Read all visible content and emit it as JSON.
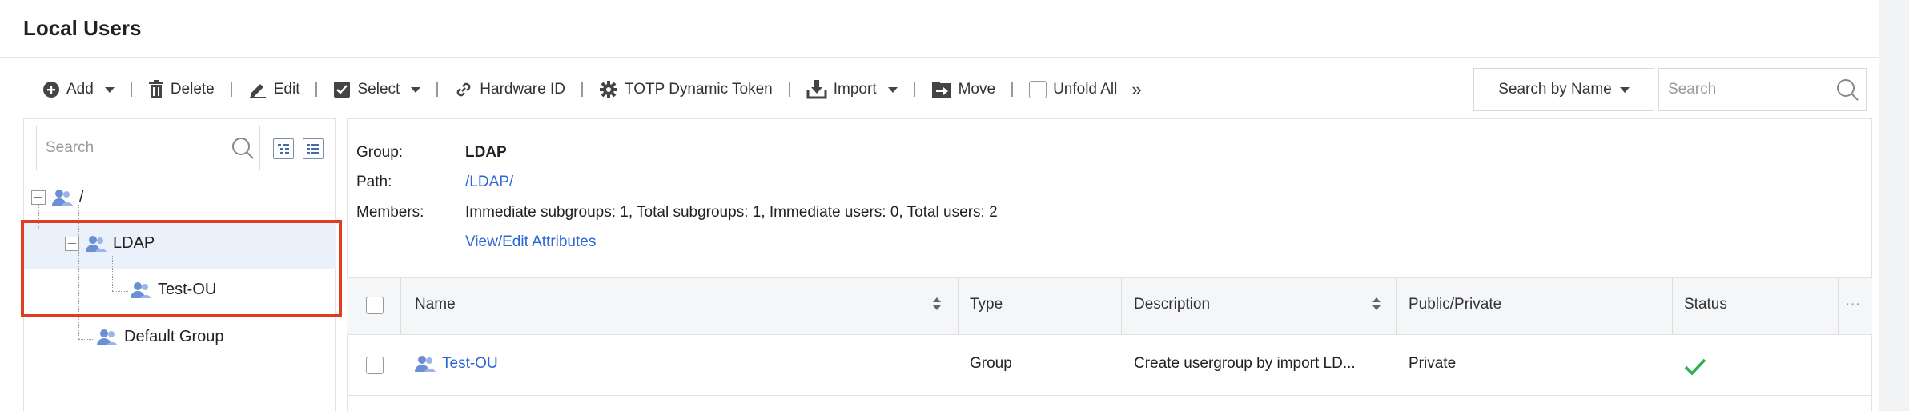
{
  "page": {
    "title": "Local Users"
  },
  "toolbar": {
    "add": "Add",
    "delete": "Delete",
    "edit": "Edit",
    "select": "Select",
    "hardware_id": "Hardware ID",
    "totp": "TOTP Dynamic Token",
    "import": "Import",
    "move": "Move",
    "unfold_all": "Unfold All",
    "more": "»",
    "search_by": "Search by Name",
    "search_placeholder": "Search"
  },
  "tree": {
    "search_placeholder": "Search",
    "root": "/",
    "ldap": "LDAP",
    "test_ou": "Test-OU",
    "default_group": "Default Group"
  },
  "detail": {
    "group_label": "Group:",
    "group_value": "LDAP",
    "path_label": "Path:",
    "path_value": "/LDAP/",
    "members_label": "Members:",
    "members_value": "Immediate subgroups: 1, Total subgroups: 1, Immediate users: 0, Total users: 2",
    "view_edit": "View/Edit Attributes"
  },
  "table": {
    "columns": [
      "Name",
      "Type",
      "Description",
      "Public/Private",
      "Status",
      "···"
    ],
    "rows": [
      {
        "name": "Test-OU",
        "type": "Group",
        "description": "Create usergroup by import LD...",
        "visibility": "Private",
        "status": "enabled"
      }
    ]
  },
  "colors": {
    "link": "#2d66d6",
    "highlight_border": "#e03c25",
    "status_ok": "#2bb04a"
  }
}
